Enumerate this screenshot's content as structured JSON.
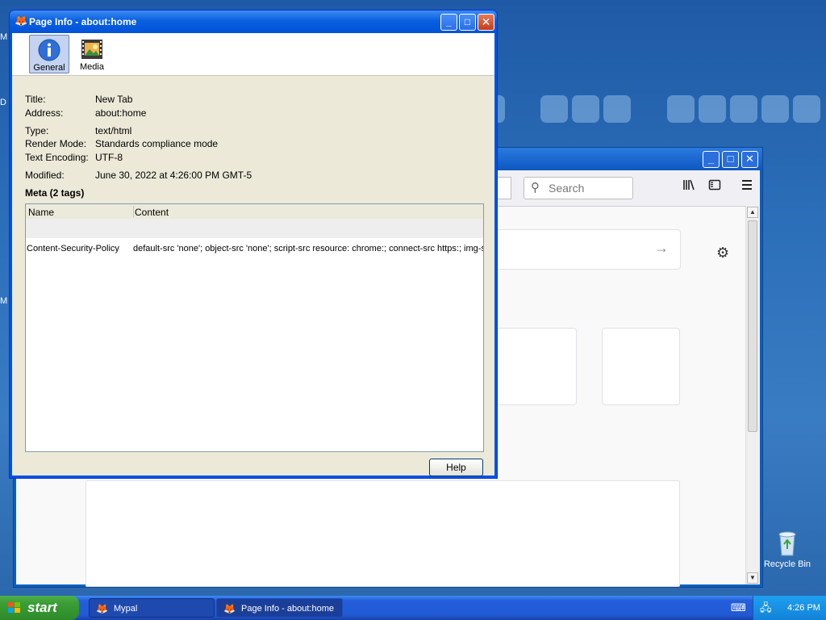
{
  "desktop": {
    "recycle_bin_label": "Recycle Bin",
    "edge_letters": [
      "D",
      "M",
      "M"
    ]
  },
  "browser": {
    "search_placeholder": "Search",
    "icons": [
      "library-icon",
      "sidebar-icon",
      "menu-icon",
      "gear-icon",
      "arrow-right-icon"
    ]
  },
  "dialog": {
    "title": "Page Info - about:home",
    "tabs": [
      {
        "label": "General",
        "selected": true
      },
      {
        "label": "Media",
        "selected": false
      }
    ],
    "fields": [
      {
        "key": "Title:",
        "value": "New Tab"
      },
      {
        "key": "Address:",
        "value": "about:home"
      },
      {
        "key": "Type:",
        "value": "text/html"
      },
      {
        "key": "Render Mode:",
        "value": "Standards compliance mode"
      },
      {
        "key": "Text Encoding:",
        "value": "UTF-8"
      },
      {
        "key": "Modified:",
        "value": "June 30, 2022 at 4:26:00 PM GMT-5"
      }
    ],
    "meta_heading": "Meta (2 tags)",
    "table": {
      "columns": [
        "Name",
        "Content"
      ],
      "rows": [
        {
          "name": "Content-Security-Policy",
          "content": "default-src 'none'; object-src 'none'; script-src resource: chrome:; connect-src https:; img-sr..."
        }
      ]
    },
    "help_label": "Help"
  },
  "taskbar": {
    "start_label": "start",
    "tasks": [
      {
        "label": "Mypal",
        "active": false
      },
      {
        "label": "Page Info - about:home",
        "active": true
      }
    ],
    "clock": "4:26 PM"
  },
  "colors": {
    "xp_blue": "#0054e3",
    "desktop": "#2d70ba",
    "start_green": "#3a9e35",
    "close_red": "#c33c1b"
  }
}
